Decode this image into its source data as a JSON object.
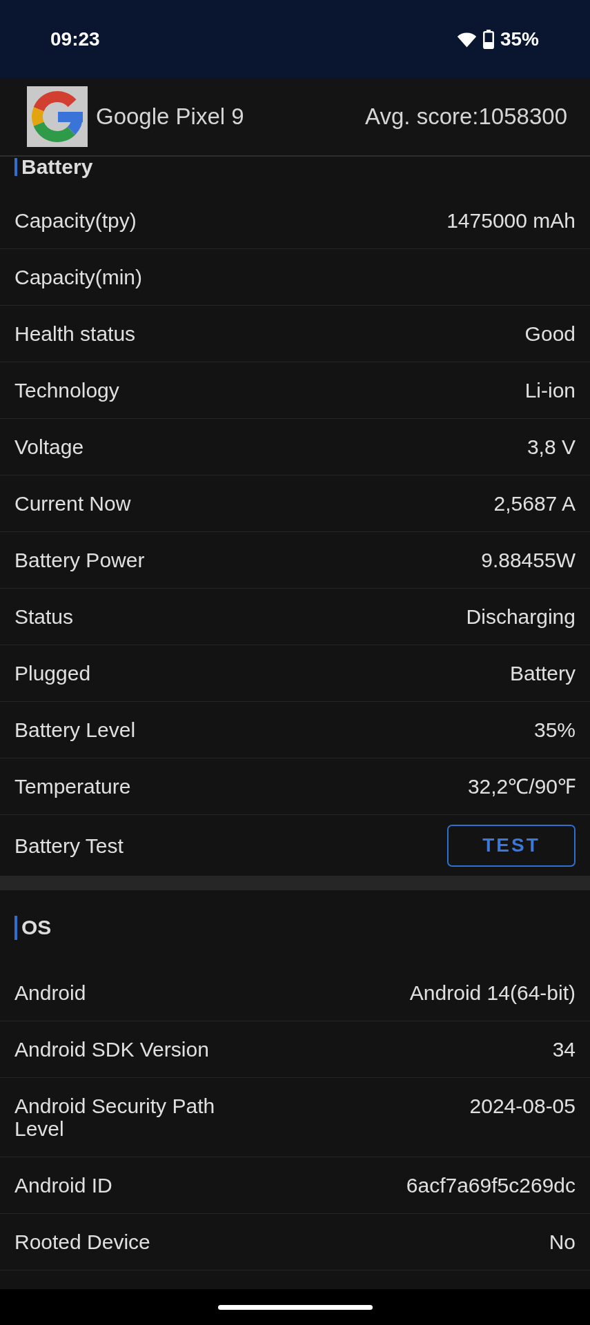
{
  "status_bar": {
    "time": "09:23",
    "battery": "35%"
  },
  "header": {
    "device_name": "Google Pixel 9",
    "avg_score": "Avg. score:1058300"
  },
  "sections": [
    {
      "title": "Battery",
      "rows": [
        {
          "kind": "value",
          "label": "Capacity(tpy)",
          "value": "1475000 mAh"
        },
        {
          "kind": "value",
          "label": "Capacity(min)"
        },
        {
          "kind": "value",
          "label": "Health status",
          "value": "Good"
        },
        {
          "kind": "value",
          "label": "Technology",
          "value": "Li-ion"
        },
        {
          "kind": "value",
          "label": "Voltage",
          "value": "3,8 V"
        },
        {
          "kind": "value",
          "label": "Current Now",
          "value": "2,5687 A"
        },
        {
          "kind": "value",
          "label": "Battery Power",
          "value": "9.88455W"
        },
        {
          "kind": "value",
          "label": "Status",
          "value": "Discharging"
        },
        {
          "kind": "value",
          "label": "Plugged",
          "value": "Battery"
        },
        {
          "kind": "value",
          "label": "Battery Level",
          "value": "35%"
        },
        {
          "kind": "value",
          "label": "Temperature",
          "value": "32,2℃/90℉"
        },
        {
          "kind": "button",
          "label": "Battery Test",
          "button": "TEST"
        }
      ]
    },
    {
      "title": "OS",
      "rows": [
        {
          "kind": "value",
          "label": "Android",
          "value": "Android 14(64-bit)"
        },
        {
          "kind": "value",
          "label": "Android SDK Version",
          "value": "34"
        },
        {
          "kind": "value",
          "label": "Android Security Path Level",
          "value": "2024-08-05"
        },
        {
          "kind": "value",
          "label": "Android ID",
          "value": "6acf7a69f5c269dc"
        },
        {
          "kind": "value",
          "label": "Rooted Device",
          "value": "No"
        }
      ]
    }
  ]
}
